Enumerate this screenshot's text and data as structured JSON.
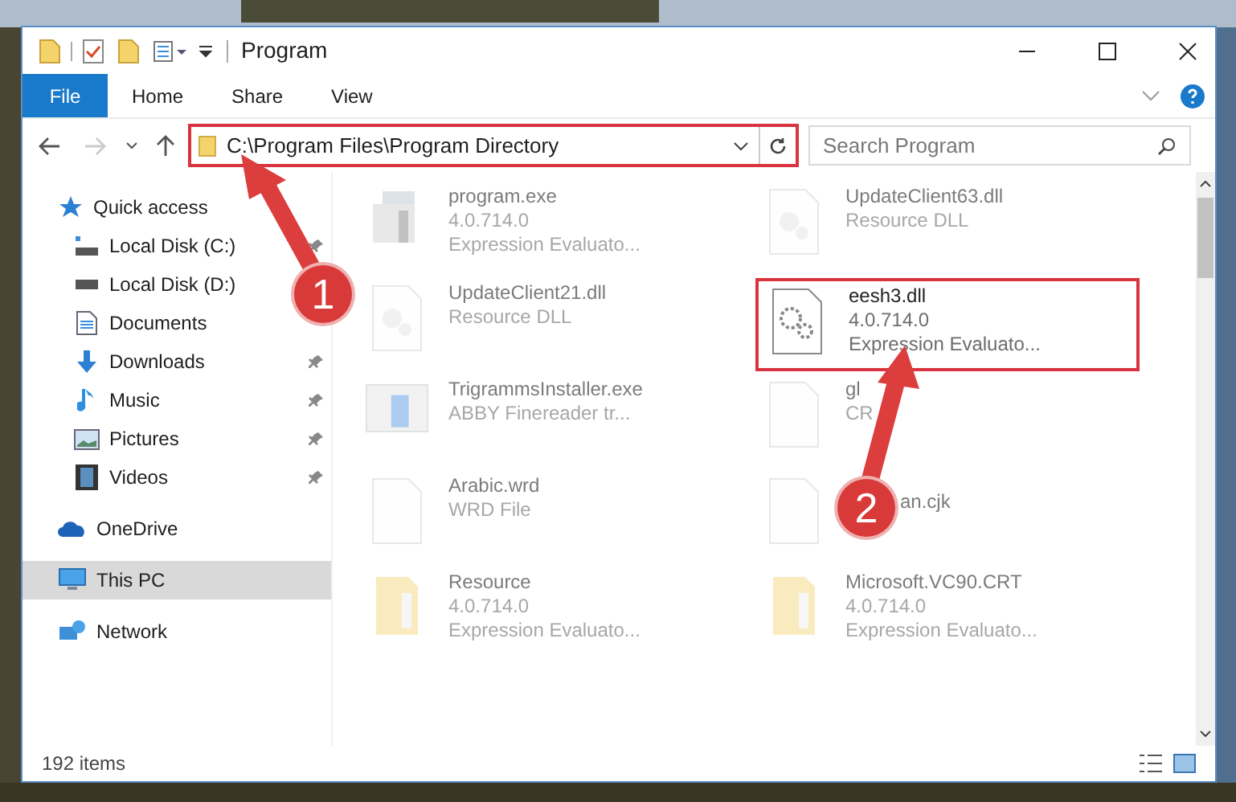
{
  "window": {
    "title": "Program"
  },
  "ribbon_tabs": [
    {
      "label": "File",
      "kind": "file"
    },
    {
      "label": "Home",
      "kind": "tab"
    },
    {
      "label": "Share",
      "kind": "tab"
    },
    {
      "label": "View",
      "kind": "tab"
    }
  ],
  "address_bar": {
    "path": "C:\\Program Files\\Program Directory"
  },
  "search": {
    "placeholder": "Search Program"
  },
  "sidebar": {
    "items": [
      {
        "label": "Quick access",
        "selected": false,
        "children": [
          {
            "label": "Local Disk (C:)",
            "pinned": true
          },
          {
            "label": "Local Disk (D:)"
          },
          {
            "label": "Documents"
          },
          {
            "label": "Downloads",
            "pinned": true
          },
          {
            "label": "Music",
            "pinned": true
          },
          {
            "label": "Pictures",
            "pinned": true
          },
          {
            "label": "Videos",
            "pinned": true
          }
        ]
      },
      {
        "label": "OneDrive",
        "selected": false
      },
      {
        "label": "This PC",
        "selected": true
      },
      {
        "label": "Network",
        "selected": false
      }
    ]
  },
  "files": [
    {
      "kind": "exe",
      "name": "program.exe",
      "lines": [
        "4.0.714.0",
        "Expression Evaluato..."
      ],
      "highlighted": false
    },
    {
      "kind": "dll",
      "name": "UpdateClient63.dll",
      "lines": [
        "Resource DLL"
      ],
      "highlighted": false
    },
    {
      "kind": "dll",
      "name": "UpdateClient21.dll",
      "lines": [
        "Resource DLL"
      ],
      "highlighted": false
    },
    {
      "kind": "gear",
      "name": "eesh3.dll",
      "lines": [
        "4.0.714.0",
        "Expression Evaluato..."
      ],
      "highlighted": true
    },
    {
      "kind": "installer",
      "name": "TrigrammsInstaller.exe",
      "lines": [
        "ABBY Finereader tr..."
      ],
      "highlighted": false
    },
    {
      "kind": "blank",
      "name": "gl",
      "lines": [
        "CR"
      ],
      "highlighted": false
    },
    {
      "kind": "blank",
      "name": "Arabic.wrd",
      "lines": [
        "WRD File"
      ],
      "highlighted": false
    },
    {
      "kind": "blank",
      "name": "an.cjk",
      "highlighted": false,
      "covered": true
    },
    {
      "kind": "folder",
      "name": "Resource",
      "lines": [
        "4.0.714.0",
        "Expression Evaluato..."
      ],
      "highlighted": false
    },
    {
      "kind": "folder",
      "name": "Microsoft.VC90.CRT",
      "lines": [
        "4.0.714.0",
        "Expression Evaluato..."
      ],
      "highlighted": false
    }
  ],
  "annotations": [
    {
      "label": "1"
    },
    {
      "label": "2"
    }
  ],
  "status_bar": {
    "item_count": "192 items"
  }
}
